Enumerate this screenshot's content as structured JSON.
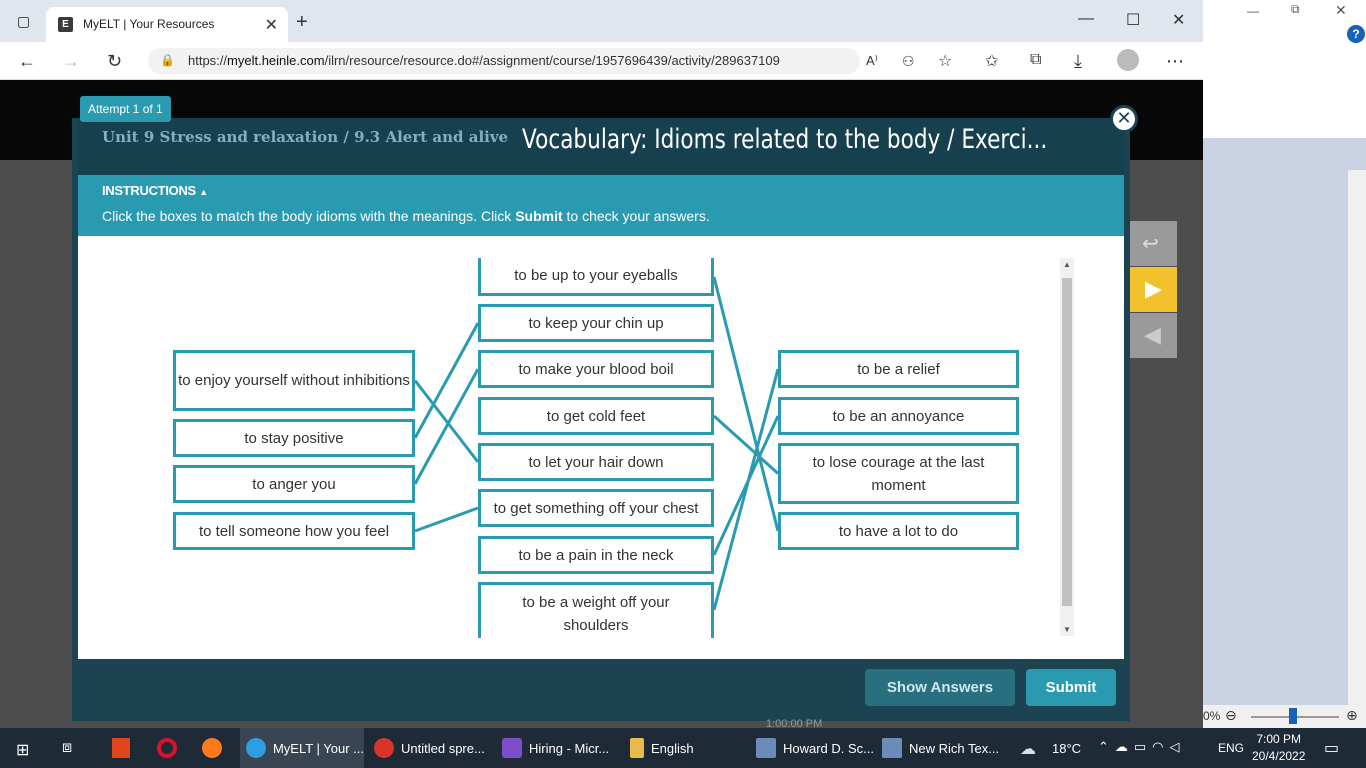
{
  "browser": {
    "tab_title": "MyELT | Your Resources",
    "tab_favicon": "E",
    "url_prefix": "https://",
    "url_host": "myelt.heinle.com",
    "url_path": "/ilrn/resource/resource.do#/assignment/course/1957696439/activity/289637109"
  },
  "modal": {
    "attempt": "Attempt 1 of 1",
    "unit_title": "Unit 9 Stress and relaxation / 9.3 Alert and alive",
    "main_title": "Vocabulary: Idioms related to the body / Exerci...",
    "instructions_heading": "INSTRUCTIONS",
    "instructions_pre": "Click the boxes to match the body idioms with the meanings. Click ",
    "instructions_bold": "Submit",
    "instructions_post": " to check your answers.",
    "show_answers": "Show Answers",
    "submit": "Submit"
  },
  "left_items": [
    "to enjoy yourself without inhibitions",
    "to stay positive",
    "to anger you",
    "to tell someone how you feel"
  ],
  "middle_items": [
    "to be up to your eyeballs",
    "to keep your chin up",
    "to make your blood boil",
    "to get cold feet",
    "to let your hair down",
    "to get something off your chest",
    "to be a pain in the neck",
    "to be a weight off your shoulders"
  ],
  "right_items": [
    "to be a relief",
    "to be an annoyance",
    "to lose courage at the last moment",
    "to have a lot to do"
  ],
  "connections": [
    {
      "from": "left.0",
      "to": "middle.4"
    },
    {
      "from": "left.1",
      "to": "middle.1"
    },
    {
      "from": "left.2",
      "to": "middle.2"
    },
    {
      "from": "left.3",
      "to": "middle.5"
    },
    {
      "from": "middle.0",
      "to": "right.3"
    },
    {
      "from": "middle.3",
      "to": "right.2"
    },
    {
      "from": "middle.6",
      "to": "right.1"
    },
    {
      "from": "middle.7",
      "to": "right.0"
    }
  ],
  "colors": {
    "accent": "#2a9ab1",
    "modal_dark": "#1c4351"
  },
  "taskbar": {
    "items": [
      "MyELT | Your ...",
      "Untitled spre...",
      "Hiring - Micr...",
      "English",
      "Howard D. Sc...",
      "New Rich Tex..."
    ],
    "temperature": "18°C",
    "language": "ENG",
    "time": "7:00 PM",
    "date": "20/4/2022"
  },
  "underlay": {
    "zoom": "0%",
    "time_text": "1:00:00 PM"
  }
}
